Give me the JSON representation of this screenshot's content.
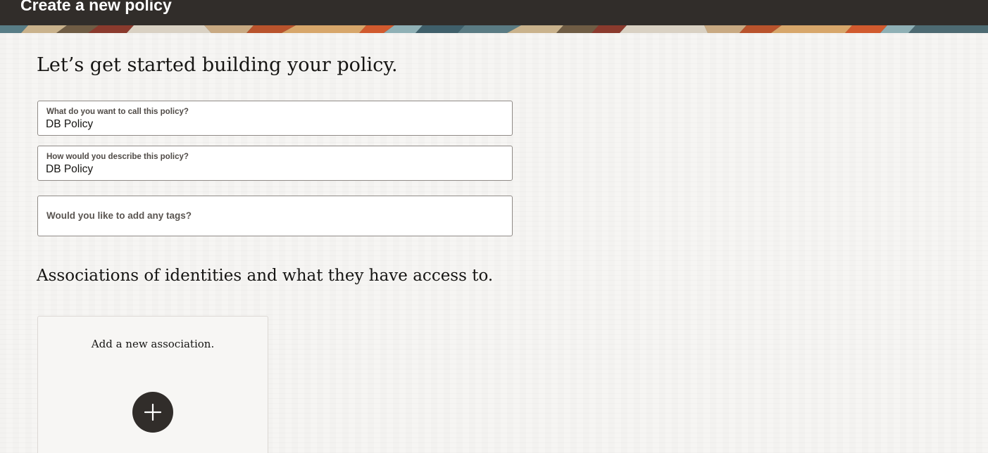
{
  "header": {
    "title": "Create a new policy"
  },
  "intro": {
    "heading": "Let’s get started building your policy."
  },
  "form": {
    "name_field": {
      "label": "What do you want to call this policy?",
      "value": "DB Policy"
    },
    "description_field": {
      "label": "How would you describe this policy?",
      "value": "DB Policy"
    },
    "tags_field": {
      "placeholder": "Would you like to add any tags?"
    }
  },
  "associations": {
    "heading": "Associations of identities and what they have access to.",
    "card": {
      "title": "Add a new association.",
      "add_icon": "plus-icon"
    }
  },
  "colors": {
    "header_bg": "#312d2a",
    "page_bg": "#f6f5f3",
    "button_bg": "#312d2a",
    "field_border": "#908b87"
  }
}
